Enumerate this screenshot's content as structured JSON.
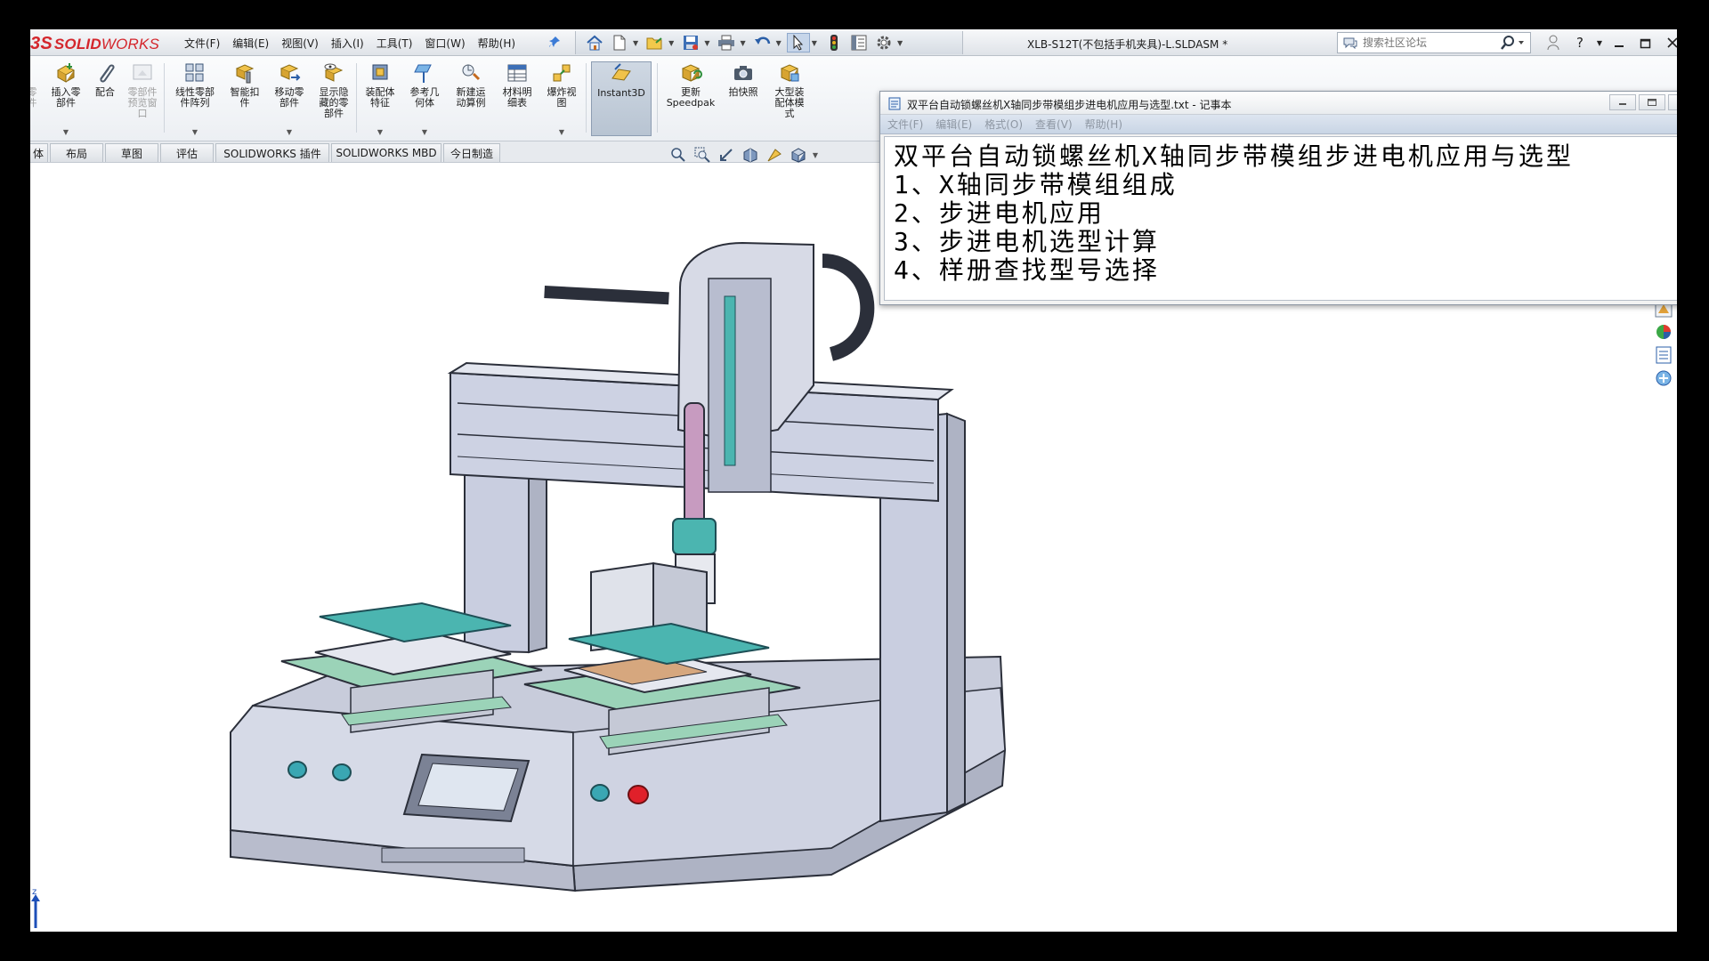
{
  "solidworks": {
    "logo_prefix": "3S",
    "logo_solid": "SOLID",
    "logo_works": "WORKS",
    "menu": [
      "文件(F)",
      "编辑(E)",
      "视图(V)",
      "插入(I)",
      "工具(T)",
      "窗口(W)",
      "帮助(H)"
    ],
    "document_title": "XLB-S12T(不包括手机夹具)-L.SLDASM *",
    "search_placeholder": "搜索社区论坛",
    "ribbon": [
      {
        "label": "零\n件",
        "enabled": false
      },
      {
        "label": "插入零\n部件",
        "enabled": true
      },
      {
        "label": "配合",
        "enabled": true
      },
      {
        "label": "零部件\n预览窗\n口",
        "enabled": false
      },
      {
        "label": "线性零部\n件阵列",
        "enabled": true
      },
      {
        "label": "智能扣\n件",
        "enabled": true
      },
      {
        "label": "移动零\n部件",
        "enabled": true
      },
      {
        "label": "显示隐\n藏的零\n部件",
        "enabled": true
      },
      {
        "label": "装配体\n特征",
        "enabled": true
      },
      {
        "label": "参考几\n何体",
        "enabled": true
      },
      {
        "label": "新建运\n动算例",
        "enabled": true
      },
      {
        "label": "材料明\n细表",
        "enabled": true
      },
      {
        "label": "爆炸视\n图",
        "enabled": true
      },
      {
        "label": "Instant3D",
        "enabled": true
      },
      {
        "label": "更新\nSpeedpak",
        "enabled": true
      },
      {
        "label": "拍快照",
        "enabled": true
      },
      {
        "label": "大型装\n配体模\n式",
        "enabled": true
      }
    ],
    "tabs": [
      "体",
      "布局",
      "草图",
      "评估",
      "SOLIDWORKS 插件",
      "SOLIDWORKS MBD",
      "今日制造"
    ],
    "triad_axis": "z"
  },
  "notepad": {
    "title": "双平台自动锁螺丝机X轴同步带模组步进电机应用与选型.txt - 记事本",
    "menu": [
      "文件(F)",
      "编辑(E)",
      "格式(O)",
      "查看(V)",
      "帮助(H)"
    ],
    "lines": [
      "双平台自动锁螺丝机X轴同步带模组步进电机应用与选型",
      "1、X轴同步带模组组成",
      "2、步进电机应用",
      "3、步进电机选型计算",
      "4、样册查找型号选择"
    ]
  },
  "colors": {
    "logo_red": "#d4262c",
    "machine_body": "#cfd4e3",
    "machine_outline": "#2b2f3a",
    "fixture_green": "#9bd3b8",
    "teal_rail": "#4bb5b0",
    "spindle_purple": "#c79bc0",
    "button_red": "#e0202a",
    "knob_teal": "#3aa7b3",
    "pcb_brown": "#d6a77e"
  }
}
